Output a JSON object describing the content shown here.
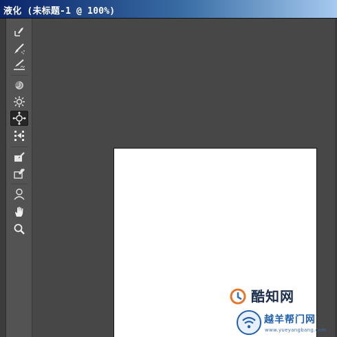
{
  "window": {
    "title": "液化 (未标题-1 @ 100%)"
  },
  "tools": [
    {
      "name": "forward-warp-tool",
      "icon": "forward-warp-icon",
      "active": false
    },
    {
      "name": "reconstruct-tool",
      "icon": "reconstruct-brush-icon",
      "active": false
    },
    {
      "name": "smooth-tool",
      "icon": "smooth-brush-icon",
      "active": false
    },
    {
      "name": "twirl-clockwise-tool",
      "icon": "twirl-icon",
      "active": false
    },
    {
      "name": "pucker-tool",
      "icon": "pucker-icon",
      "active": false
    },
    {
      "name": "bloat-tool",
      "icon": "bloat-icon",
      "active": true
    },
    {
      "name": "push-left-tool",
      "icon": "push-left-icon",
      "active": false
    },
    {
      "name": "freeze-mask-tool",
      "icon": "freeze-mask-icon",
      "active": false
    },
    {
      "name": "thaw-mask-tool",
      "icon": "thaw-mask-icon",
      "active": false
    },
    {
      "name": "face-tool",
      "icon": "face-icon",
      "active": false
    },
    {
      "name": "hand-tool",
      "icon": "hand-icon",
      "active": false
    },
    {
      "name": "zoom-tool",
      "icon": "magnifier-icon",
      "active": false
    }
  ],
  "watermarks": {
    "primary": {
      "text": "酷知网"
    },
    "secondary": {
      "text": "越羊帮门网",
      "url": "www.yueyangbang.com"
    }
  },
  "colors": {
    "title_bar_start": "#0a246a",
    "title_bar_end": "#a6caf0",
    "workspace": "#474747",
    "toolbar": "#535353",
    "canvas": "#ffffff"
  }
}
